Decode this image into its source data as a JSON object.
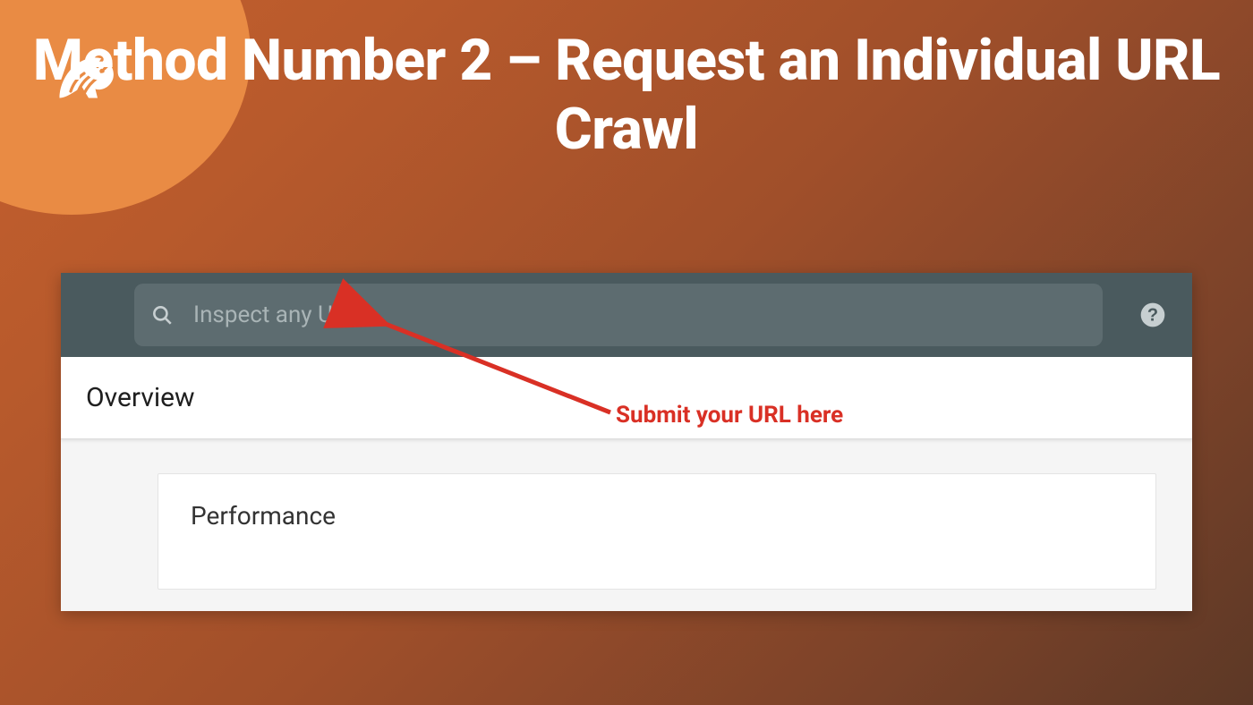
{
  "slide": {
    "title": "Method Number 2 – Request an Individual URL Crawl"
  },
  "console": {
    "search_placeholder": "Inspect any URL",
    "overview_label": "Overview",
    "performance_label": "Performance"
  },
  "annotation": {
    "text": "Submit your URL here"
  }
}
